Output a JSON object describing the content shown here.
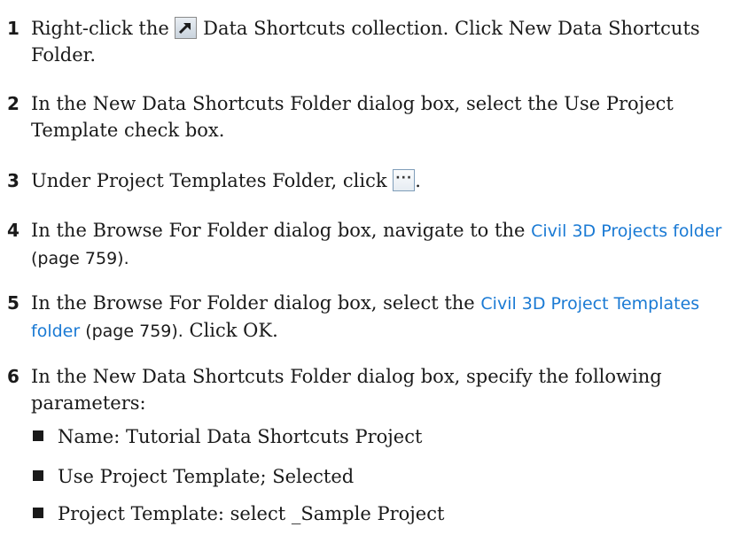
{
  "steps": [
    {
      "number": "1",
      "before_icon": "Right-click the ",
      "icon": "data-shortcuts-collection-icon",
      "after_icon": " Data Shortcuts collection. Click New Data Shortcuts Folder."
    },
    {
      "number": "2",
      "text": "In the New Data Shortcuts Folder dialog box, select the Use Project Template check box."
    },
    {
      "number": "3",
      "before_icon": "Under Project Templates Folder, click ",
      "icon": "ellipsis-browse-icon",
      "after_icon": "."
    },
    {
      "number": "4",
      "text_before_link": "In the Browse For Folder dialog box, navigate to the ",
      "link": "Civil 3D Projects folder",
      "pageref": " (page 759)."
    },
    {
      "number": "5",
      "text_before_link": "In the Browse For Folder dialog box, select the ",
      "link": "Civil 3D Project Templates folder",
      "pageref": " (page 759).",
      "after": " Click OK."
    },
    {
      "number": "6",
      "text": "In the New Data Shortcuts Folder dialog box, specify the following parameters:",
      "bullets": [
        "Name: Tutorial Data Shortcuts Project",
        "Use Project Template; Selected",
        "Project Template: select _Sample Project"
      ]
    }
  ],
  "colors": {
    "text": "#1a1a1a",
    "link": "#1a7ad4"
  }
}
